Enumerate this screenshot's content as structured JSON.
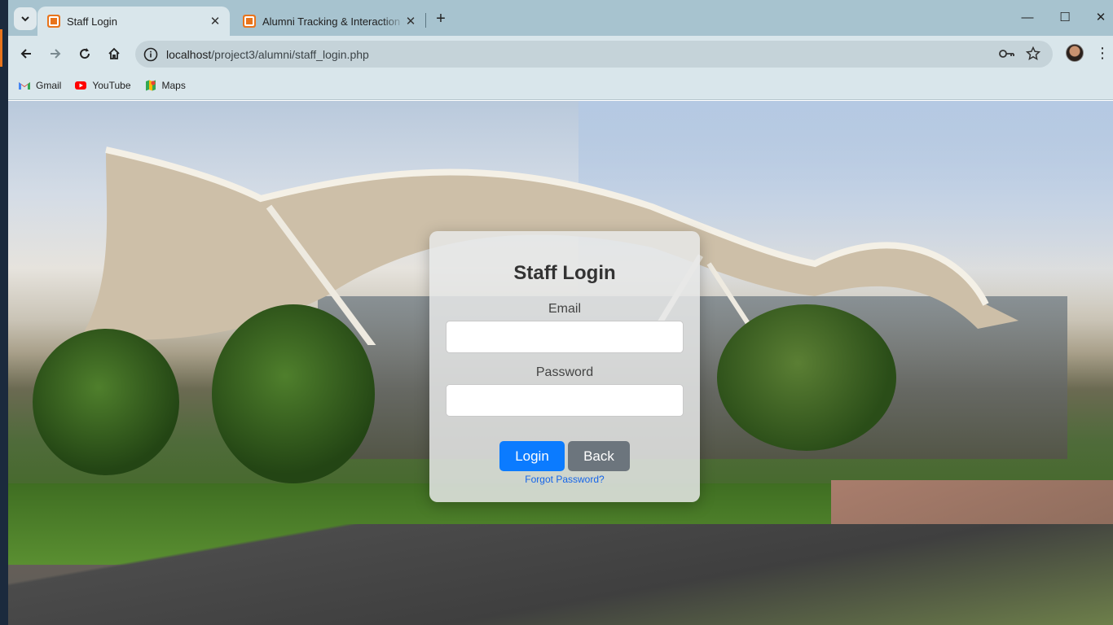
{
  "browser": {
    "tabs": [
      {
        "title": "Staff Login",
        "active": true
      },
      {
        "title": "Alumni Tracking & Interaction P",
        "active": false
      }
    ],
    "url_host": "localhost",
    "url_path": "/project3/alumni/staff_login.php",
    "bookmarks": [
      {
        "label": "Gmail",
        "icon": "gmail-icon"
      },
      {
        "label": "YouTube",
        "icon": "youtube-icon"
      },
      {
        "label": "Maps",
        "icon": "maps-icon"
      }
    ]
  },
  "login_form": {
    "title": "Staff Login",
    "email_label": "Email",
    "email_value": "",
    "password_label": "Password",
    "password_value": "",
    "login_button": "Login",
    "back_button": "Back",
    "forgot_link": "Forgot Password?"
  },
  "colors": {
    "login_button": "#0b7bff",
    "back_button": "#6c757d",
    "link": "#1565e8",
    "tab_strip": "#a7c3cf",
    "toolbar": "#d9e6eb"
  }
}
